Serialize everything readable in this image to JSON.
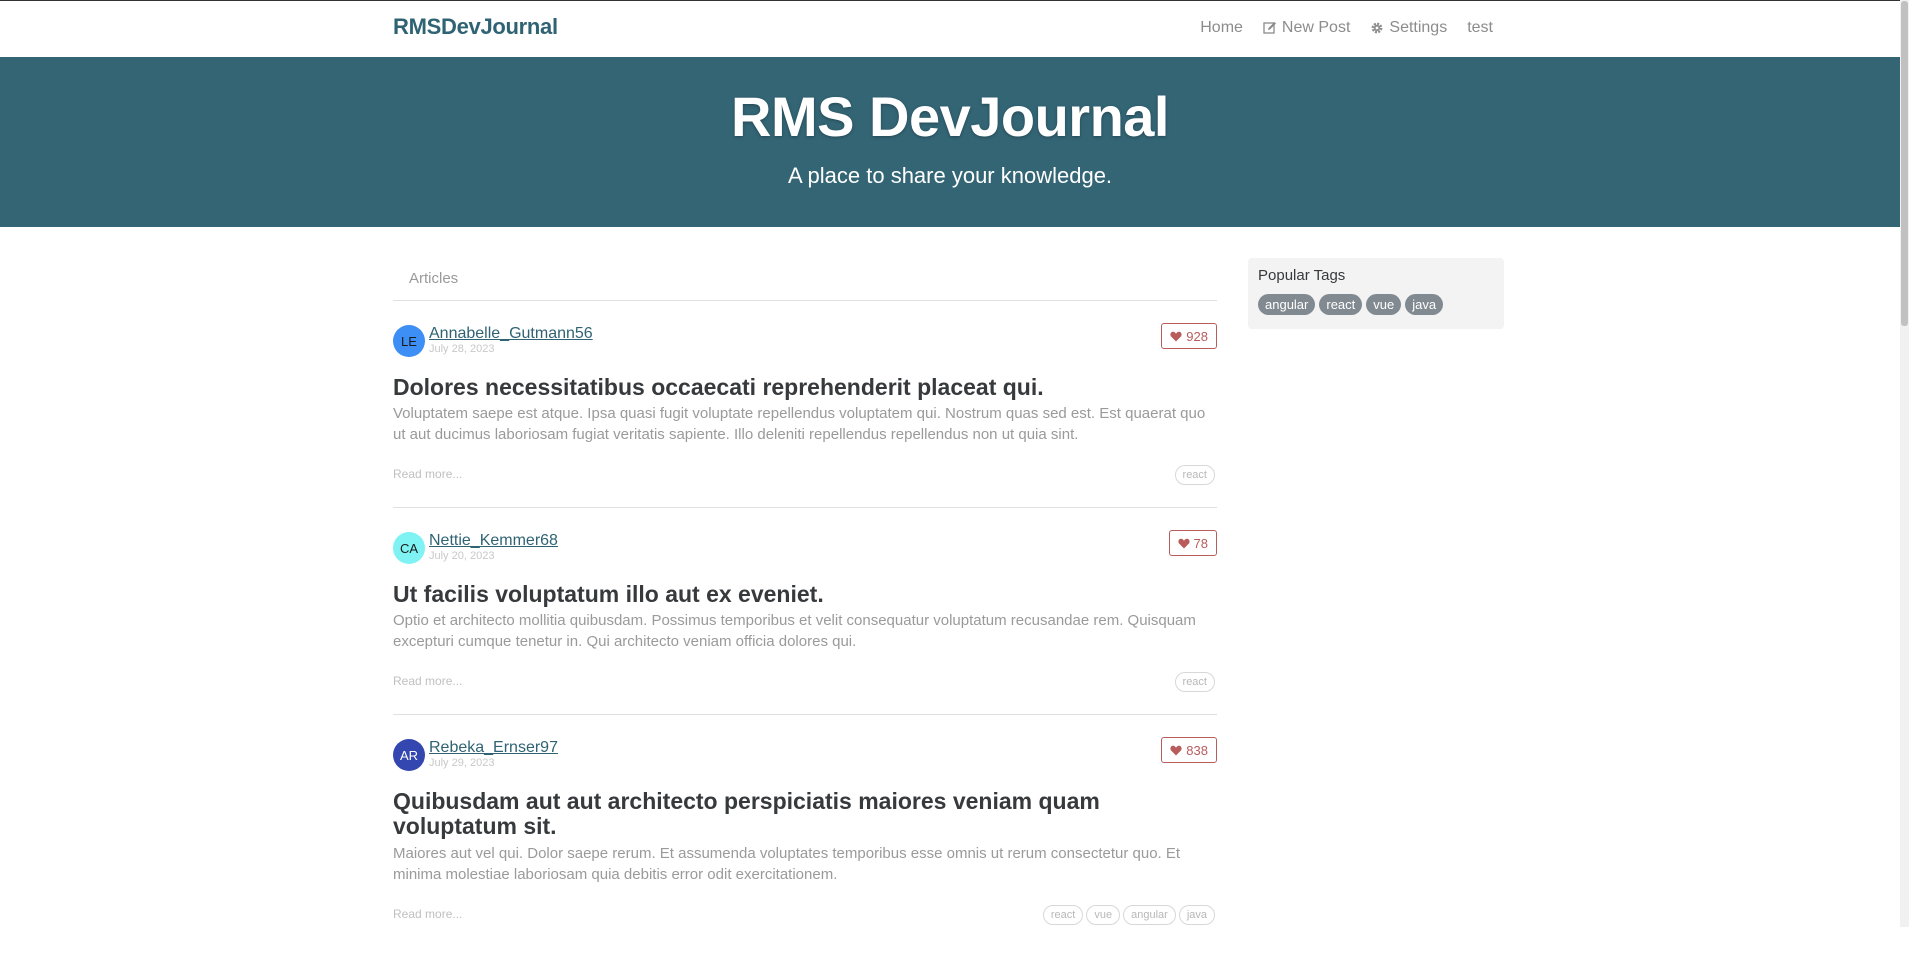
{
  "nav": {
    "brand": "RMSDevJournal",
    "home": "Home",
    "new_post": "New Post",
    "settings": "Settings",
    "user": "test"
  },
  "banner": {
    "title": "RMS DevJournal",
    "subtitle": "A place to share your knowledge."
  },
  "feed": {
    "tab": "Articles",
    "read_more": "Read more...",
    "articles": [
      {
        "initials": "LE",
        "avatar_bg": "#3d8ef5",
        "avatar_fg": "#1a1a1a",
        "author": "Annabelle_Gutmann56",
        "date": "July 28, 2023",
        "favorites": "928",
        "title": "Dolores necessitatibus occaecati reprehenderit placeat qui.",
        "description": "Voluptatem saepe est atque. Ipsa quasi fugit voluptate repellendus voluptatem qui. Nostrum quas sed est. Est quaerat quo ut aut ducimus laboriosam fugiat veritatis sapiente. Illo deleniti repellendus repellendus non ut quia sint.",
        "tags": [
          "react"
        ]
      },
      {
        "initials": "CA",
        "avatar_bg": "#7ff3f3",
        "avatar_fg": "#1a1a1a",
        "author": "Nettie_Kemmer68",
        "date": "July 20, 2023",
        "favorites": "78",
        "title": "Ut facilis voluptatum illo aut ex eveniet.",
        "description": "Optio et architecto mollitia quibusdam. Possimus temporibus et velit consequatur voluptatum recusandae rem. Quisquam excepturi cumque tenetur in. Qui architecto veniam officia dolores qui.",
        "tags": [
          "react"
        ]
      },
      {
        "initials": "AR",
        "avatar_bg": "#3446b0",
        "avatar_fg": "#ffffff",
        "author": "Rebeka_Ernser97",
        "date": "July 29, 2023",
        "favorites": "838",
        "title": "Quibusdam aut aut architecto perspiciatis maiores veniam quam voluptatum sit.",
        "description": "Maiores aut vel qui. Dolor saepe rerum. Et assumenda voluptates temporibus esse omnis ut rerum consectetur quo. Et minima molestiae laboriosam quia debitis error odit exercitationem.",
        "tags": [
          "react",
          "vue",
          "angular",
          "java"
        ]
      }
    ]
  },
  "sidebar": {
    "label": "Popular Tags",
    "tags": [
      "angular",
      "react",
      "vue",
      "java"
    ]
  }
}
